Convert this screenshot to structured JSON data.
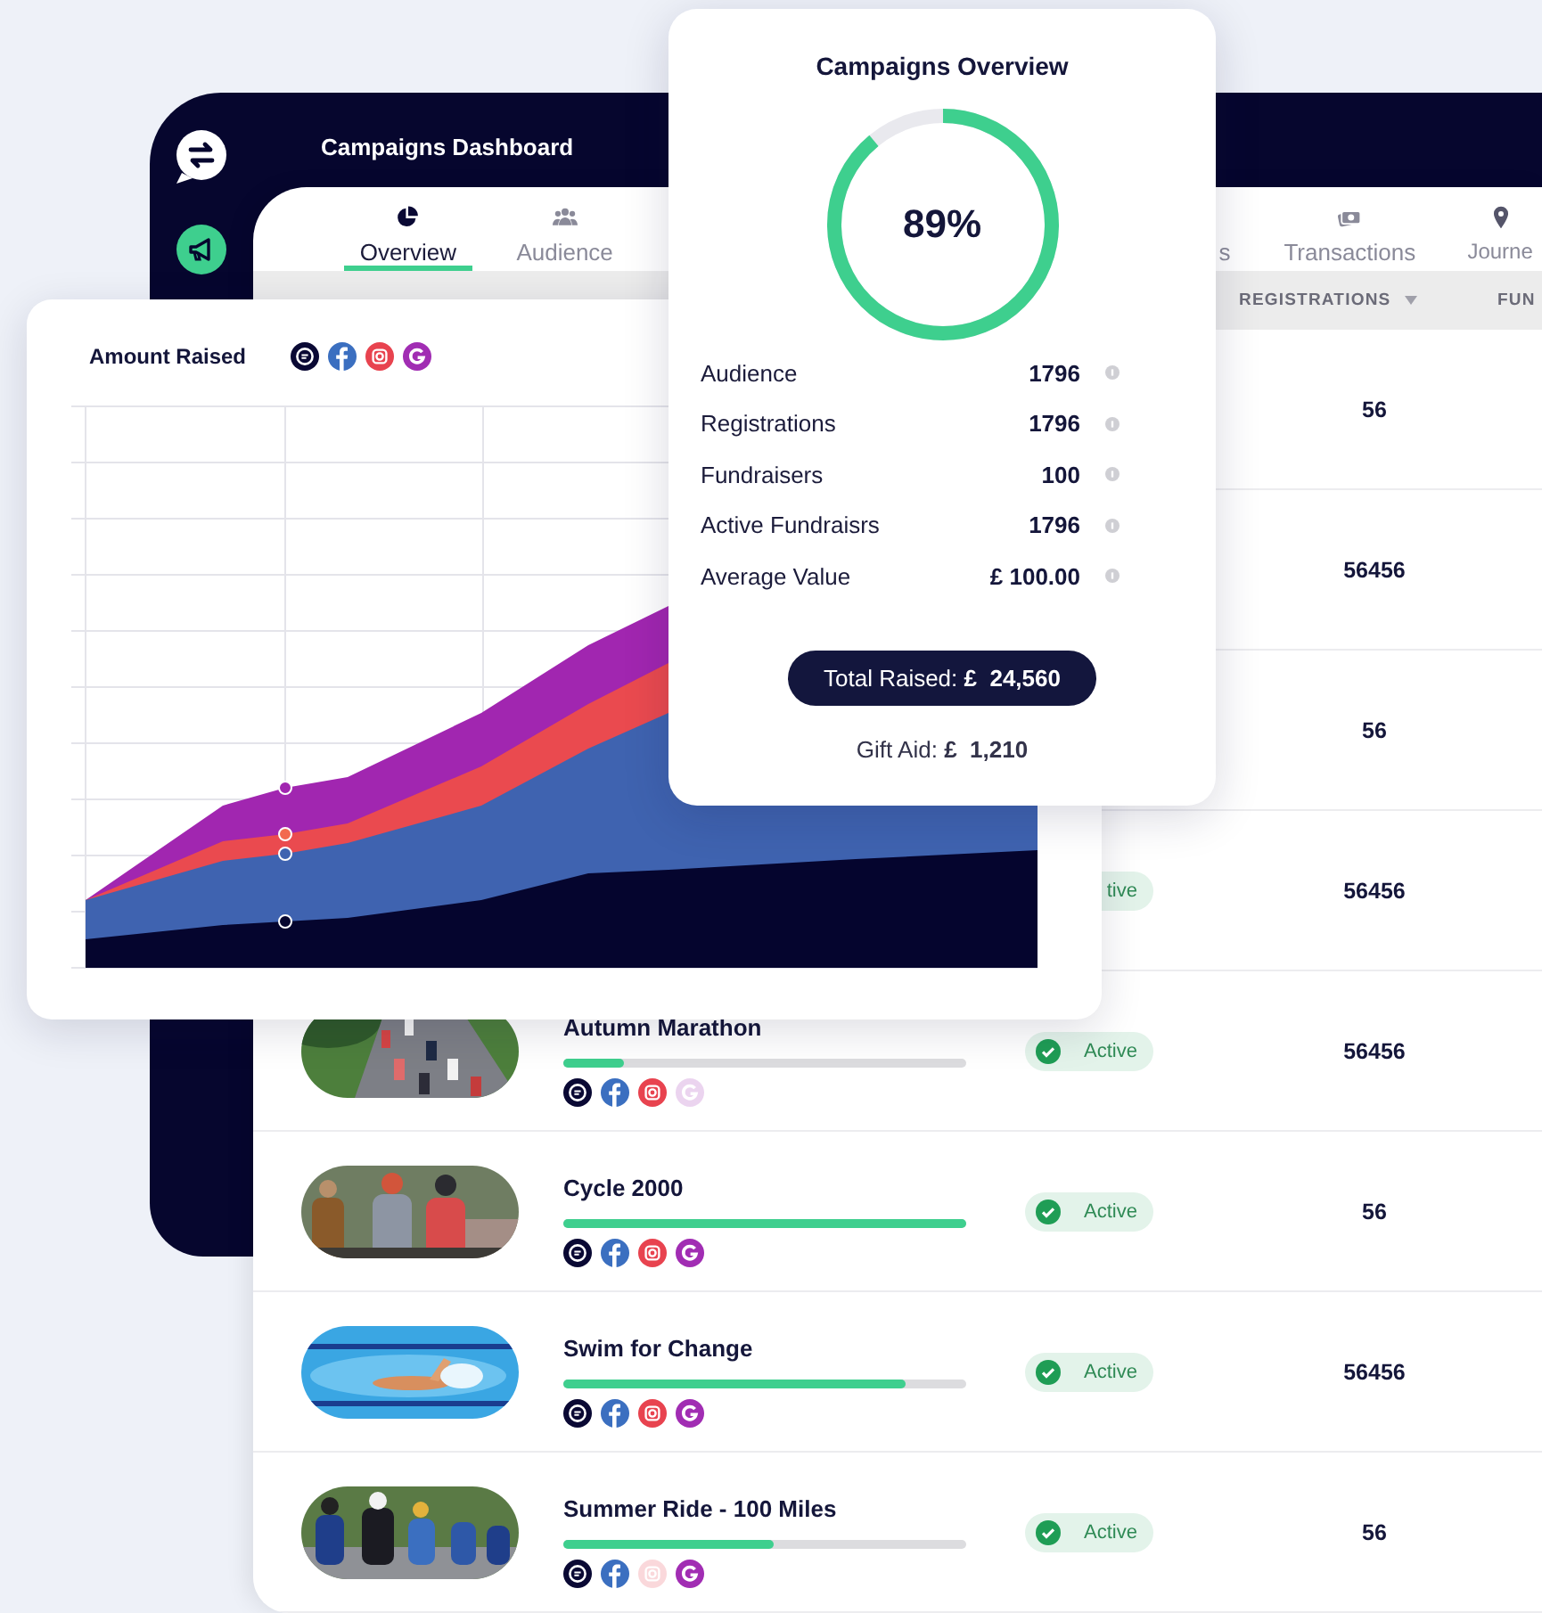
{
  "dashboard": {
    "title": "Campaigns Dashboard"
  },
  "tabs": [
    {
      "label": "Overview",
      "selected": true
    },
    {
      "label": "Audience",
      "selected": false
    },
    {
      "label": "s",
      "selected": false
    },
    {
      "label": "Transactions",
      "selected": false
    },
    {
      "label": "Journe",
      "selected": false
    }
  ],
  "table": {
    "columns": [
      {
        "label": "REGISTRATIONS",
        "sortable": true
      },
      {
        "label": "FUN"
      }
    ],
    "rows": [
      {
        "registrations": "56"
      },
      {
        "registrations": "56456"
      },
      {
        "registrations": "56"
      },
      {
        "status": "tive",
        "registrations": "56456"
      },
      {
        "photo": {
          "kind": "picture"
        },
        "name": "Autumn Marathon",
        "level": 0.15,
        "channels": [
          {
            "kind": "chat",
            "on": true
          },
          {
            "kind": "facebook",
            "on": true
          },
          {
            "kind": "instagram",
            "on": true
          },
          {
            "kind": "g",
            "on": false
          }
        ],
        "status": "Active",
        "checked": true,
        "registrations": "56456"
      },
      {
        "photo": {
          "kind": "picture"
        },
        "name": "Cycle 2000",
        "level": 1.0,
        "channels": [
          {
            "kind": "chat",
            "on": true
          },
          {
            "kind": "facebook",
            "on": true
          },
          {
            "kind": "instagram",
            "on": true
          },
          {
            "kind": "g",
            "on": true
          }
        ],
        "status": "Active",
        "checked": true,
        "registrations": "56"
      },
      {
        "photo": {
          "kind": "picture"
        },
        "name": "Swim for Change",
        "level": 0.85,
        "channels": [
          {
            "kind": "chat",
            "on": true
          },
          {
            "kind": "facebook",
            "on": true
          },
          {
            "kind": "instagram",
            "on": true
          },
          {
            "kind": "g",
            "on": true
          }
        ],
        "status": "Active",
        "checked": true,
        "registrations": "56456"
      },
      {
        "photo": {
          "kind": "picture"
        },
        "name": "Summer Ride - 100 Miles",
        "level": 0.52,
        "channels": [
          {
            "kind": "chat",
            "on": true
          },
          {
            "kind": "facebook",
            "on": true
          },
          {
            "kind": "instagram",
            "on": false
          },
          {
            "kind": "g",
            "on": true
          }
        ],
        "status": "Active",
        "checked": true,
        "registrations": "56"
      }
    ]
  },
  "amount_chart": {
    "title": "Amount Raised",
    "channels": [
      {
        "kind": "chat",
        "on": true
      },
      {
        "kind": "facebook",
        "on": true
      },
      {
        "kind": "instagram",
        "on": true
      },
      {
        "kind": "g",
        "on": true
      }
    ]
  },
  "overview": {
    "title": "Campaigns Overview",
    "progress": {
      "level": 0.89,
      "label": "89%"
    },
    "stats": [
      {
        "label": "Audience",
        "value": "1796"
      },
      {
        "label": "Registrations",
        "value": "1796"
      },
      {
        "label": "Fundraisers",
        "value": "100"
      },
      {
        "label": "Active Fundraisrs",
        "value": "1796"
      },
      {
        "label": "Average Value",
        "value": "£ 100.00"
      }
    ],
    "total": "Total Raised: **£  24,560**",
    "gift_aid": "Gift Aid: **£  1,210**"
  }
}
